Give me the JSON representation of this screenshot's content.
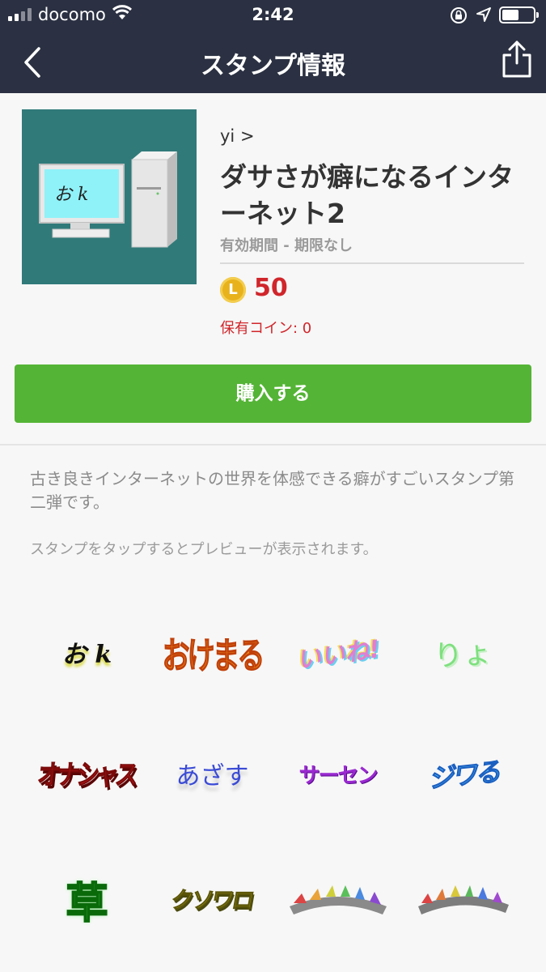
{
  "status_bar": {
    "carrier": "docomo",
    "time": "2:42"
  },
  "nav": {
    "title": "スタンプ情報",
    "back_icon": "chevron-left-icon",
    "share_icon": "share-icon"
  },
  "package": {
    "creator": "yi >",
    "title": "ダサさが癖になるインターネット2",
    "validity": "有効期間 - 期限なし",
    "coin_symbol": "L",
    "price": "50",
    "coins_owned": "保有コイン: 0",
    "thumbnail_text": "お k"
  },
  "buy_button": {
    "label": "購入する"
  },
  "description": "古き良きインターネットの世界を体感できる癖がすごいスタンプ第二弾です。",
  "preview_hint": "スタンプをタップするとプレビューが表示されます。",
  "stickers": [
    {
      "text": "お k"
    },
    {
      "text": "おけまる"
    },
    {
      "text": "いいね!"
    },
    {
      "text": "りょ"
    },
    {
      "text": "オナシャス"
    },
    {
      "text": "あざす"
    },
    {
      "text": "サーセン"
    },
    {
      "text": "ジワる"
    },
    {
      "text": "草"
    },
    {
      "text": "クソワロ"
    },
    {
      "text": ""
    },
    {
      "text": ""
    }
  ],
  "colors": {
    "nav_bg": "#2b3142",
    "buy_green": "#54b435",
    "price_red": "#d0262b",
    "thumb_teal": "#317a7a"
  }
}
